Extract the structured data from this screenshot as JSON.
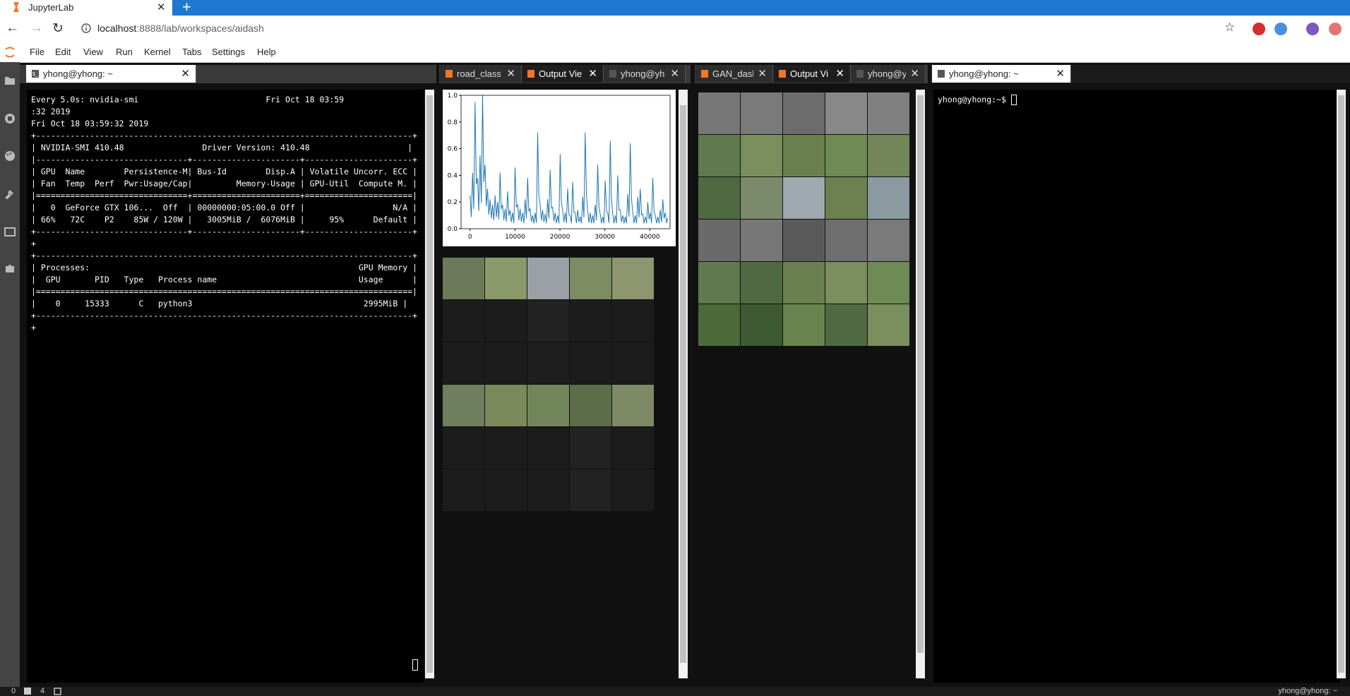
{
  "browser": {
    "tab_title": "JupyterLab",
    "new_tab": "+",
    "url_host": "localhost",
    "url_rest": ":8888/lab/workspaces/aidash"
  },
  "menu": [
    "File",
    "Edit",
    "View",
    "Run",
    "Kernel",
    "Tabs",
    "Settings",
    "Help"
  ],
  "panels": {
    "left": {
      "tab": "yhong@yhong: ~"
    },
    "mid": {
      "tabs": [
        "road_classif",
        "Output Vie",
        "yhong@yh"
      ]
    },
    "right": {
      "tabs": [
        "GAN_dasl",
        "Output Vi",
        "yhong@y"
      ]
    },
    "far": {
      "tab": "yhong@yhong: ~"
    }
  },
  "nvidia_terminal": [
    "Every 5.0s: nvidia-smi                          Fri Oct 18 03:59",
    ":32 2019",
    "Fri Oct 18 03:59:32 2019",
    "+-----------------------------------------------------------------------------+",
    "| NVIDIA-SMI 410.48                Driver Version: 410.48                    |",
    "|-------------------------------+----------------------+----------------------+",
    "| GPU  Name        Persistence-M| Bus-Id        Disp.A | Volatile Uncorr. ECC |",
    "| Fan  Temp  Perf  Pwr:Usage/Cap|         Memory-Usage | GPU-Util  Compute M. |",
    "|===============================+======================+======================|",
    "|   0  GeForce GTX 106...  Off  | 00000000:05:00.0 Off |                  N/A |",
    "| 66%   72C    P2    85W / 120W |   3005MiB /  6076MiB |     95%      Default |",
    "+-------------------------------+----------------------+----------------------+",
    "+",
    "+-----------------------------------------------------------------------------+",
    "| Processes:                                                       GPU Memory |",
    "|  GPU       PID   Type   Process name                             Usage      |",
    "|=============================================================================|",
    "|    0     15333      C   python3                                   2995MiB |",
    "+-----------------------------------------------------------------------------+",
    "+"
  ],
  "shell_prompt": "yhong@yhong:~$ ",
  "status": {
    "left1": "0",
    "left2": "4",
    "right": "yhong@yhong: ~"
  },
  "chart_data": {
    "type": "line",
    "x_ticks": [
      "0",
      "10000",
      "20000",
      "30000",
      "40000"
    ],
    "y_ticks": [
      "0.0",
      "0.2",
      "0.4",
      "0.6",
      "0.8",
      "1.0"
    ],
    "xlim": [
      -2000,
      44500
    ],
    "ylim": [
      0,
      1.0
    ],
    "color": "#1f77b4",
    "series": [
      {
        "x_start": 0,
        "x_end": 44000,
        "values": [
          0.25,
          0.42,
          0.95,
          0.38,
          0.55,
          1.0,
          0.48,
          0.3,
          0.22,
          0.18,
          0.25,
          0.2,
          0.42,
          0.18,
          0.15,
          0.28,
          0.14,
          0.12,
          0.46,
          0.18,
          0.15,
          0.12,
          0.22,
          0.38,
          0.15,
          0.1,
          0.12,
          0.72,
          0.18,
          0.14,
          0.11,
          0.22,
          0.44,
          0.16,
          0.12,
          0.1,
          0.56,
          0.14,
          0.12,
          0.3,
          0.1,
          0.35,
          0.12,
          0.14,
          0.09,
          0.24,
          0.72,
          0.13,
          0.12,
          0.1,
          0.18,
          0.48,
          0.11,
          0.09,
          0.36,
          0.12,
          0.66,
          0.11,
          0.1,
          0.4,
          0.14,
          0.1,
          0.09,
          0.26,
          0.64,
          0.12,
          0.1,
          0.24,
          0.3,
          0.11,
          0.09,
          0.2,
          0.12,
          0.38,
          0.1,
          0.09,
          0.14,
          0.22,
          0.12,
          0.08
        ]
      }
    ]
  }
}
